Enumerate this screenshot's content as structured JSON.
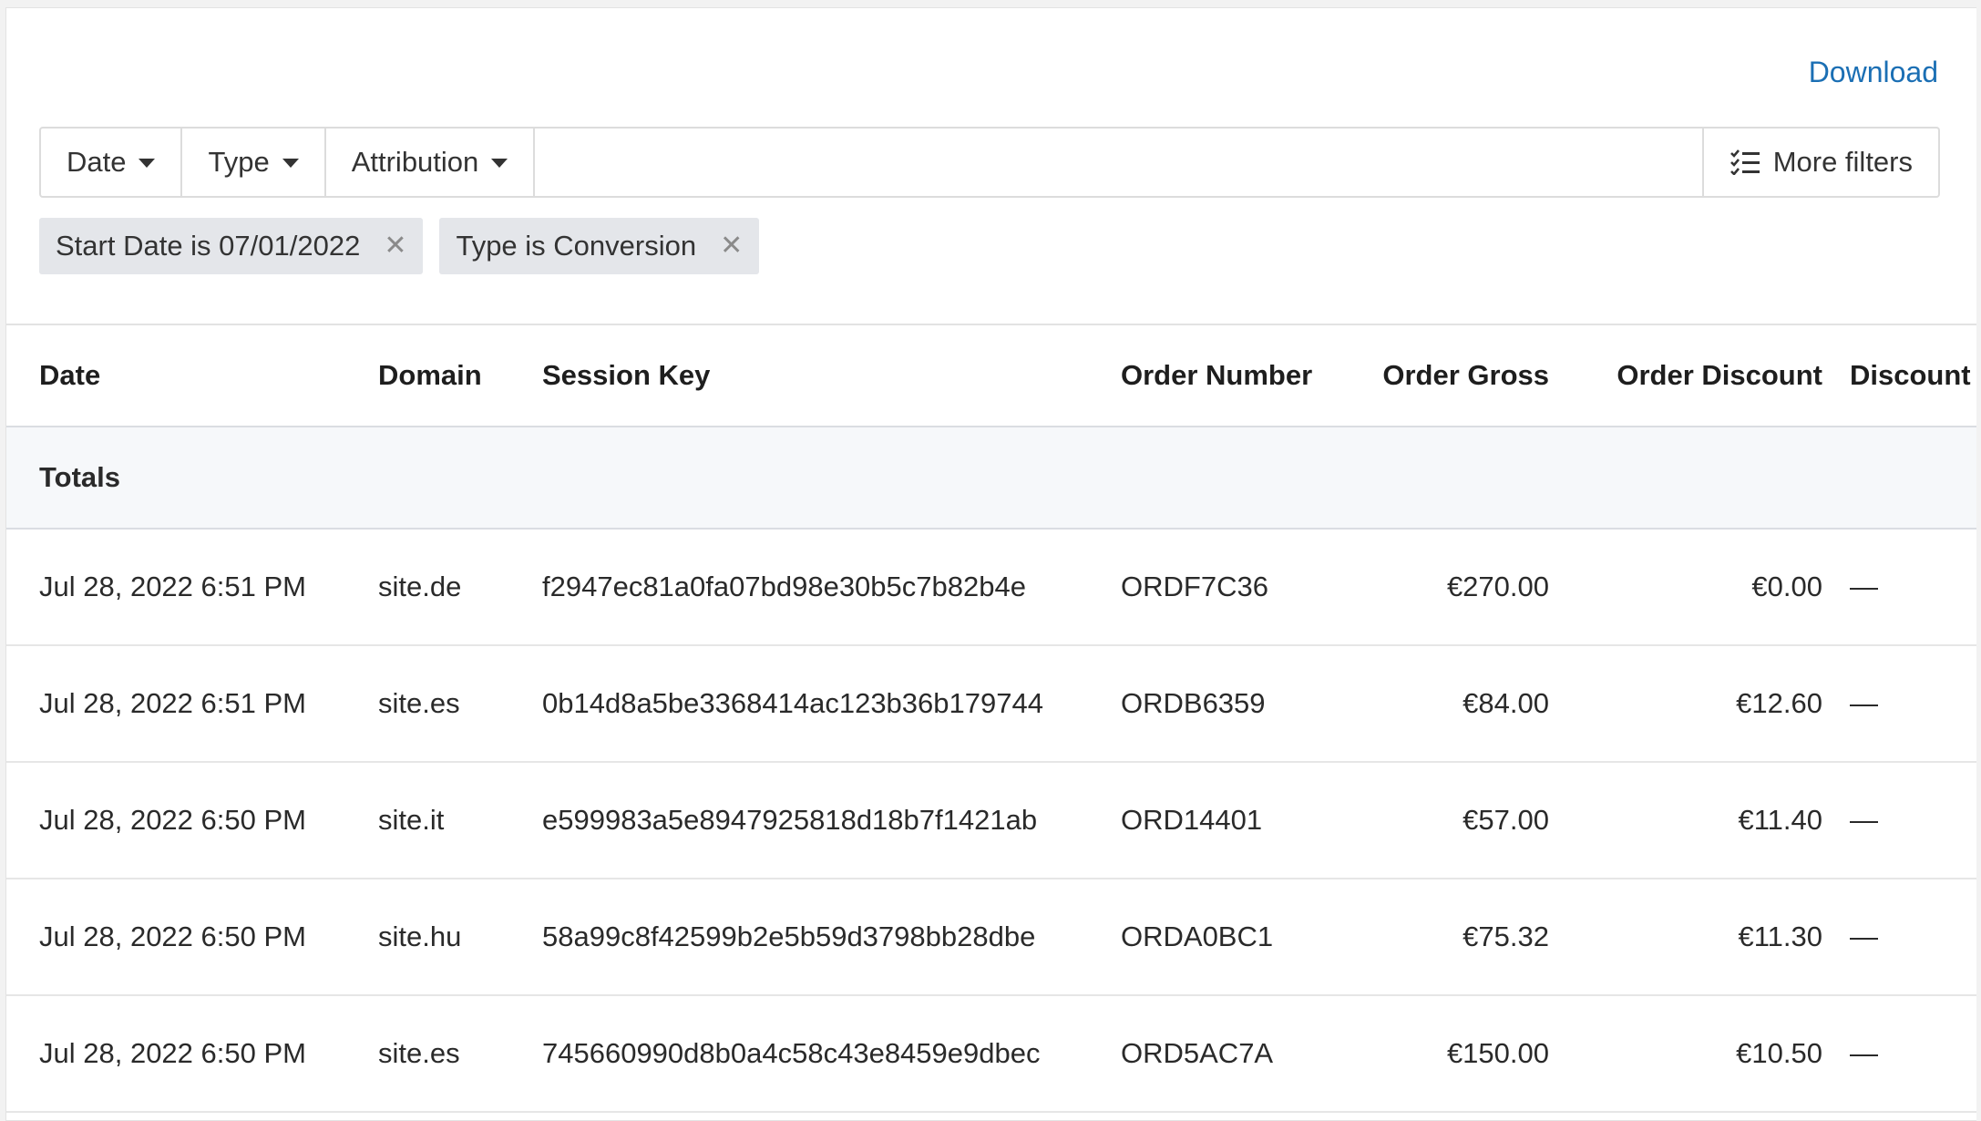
{
  "toolbar": {
    "download_label": "Download"
  },
  "filters": {
    "buttons": [
      "Date",
      "Type",
      "Attribution"
    ],
    "more_filters_label": "More filters"
  },
  "active_filters": [
    {
      "label": "Start Date is 07/01/2022"
    },
    {
      "label": "Type is Conversion"
    }
  ],
  "table": {
    "columns": [
      "Date",
      "Domain",
      "Session Key",
      "Order Number",
      "Order Gross",
      "Order Discount",
      "Discount C"
    ],
    "totals_label": "Totals",
    "rows": [
      {
        "date": "Jul 28, 2022 6:51 PM",
        "domain": "site.de",
        "session_key": "f2947ec81a0fa07bd98e30b5c7b82b4e",
        "order_number": "ORDF7C36",
        "order_gross": "€270.00",
        "order_discount": "€0.00",
        "discount_code": "—"
      },
      {
        "date": "Jul 28, 2022 6:51 PM",
        "domain": "site.es",
        "session_key": "0b14d8a5be3368414ac123b36b179744",
        "order_number": "ORDB6359",
        "order_gross": "€84.00",
        "order_discount": "€12.60",
        "discount_code": "—"
      },
      {
        "date": "Jul 28, 2022 6:50 PM",
        "domain": "site.it",
        "session_key": "e599983a5e8947925818d18b7f1421ab",
        "order_number": "ORD14401",
        "order_gross": "€57.00",
        "order_discount": "€11.40",
        "discount_code": "—"
      },
      {
        "date": "Jul 28, 2022 6:50 PM",
        "domain": "site.hu",
        "session_key": "58a99c8f42599b2e5b59d3798bb28dbe",
        "order_number": "ORDA0BC1",
        "order_gross": "€75.32",
        "order_discount": "€11.30",
        "discount_code": "—"
      },
      {
        "date": "Jul 28, 2022 6:50 PM",
        "domain": "site.es",
        "session_key": "745660990d8b0a4c58c43e8459e9dbec",
        "order_number": "ORD5AC7A",
        "order_gross": "€150.00",
        "order_discount": "€10.50",
        "discount_code": "—"
      }
    ]
  },
  "colors": {
    "link": "#1b6fb4",
    "chip_bg": "#e4e6ea",
    "totals_bg": "#f6f8fa"
  }
}
